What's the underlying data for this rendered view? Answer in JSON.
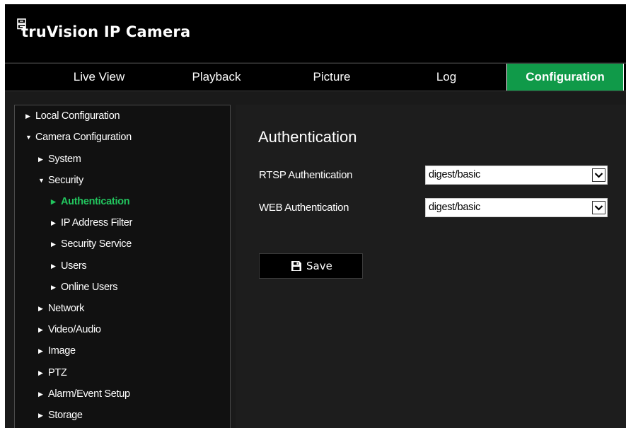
{
  "app": {
    "brand": "truVision IP Camera"
  },
  "nav": {
    "tabs": [
      {
        "label": "Live View"
      },
      {
        "label": "Playback"
      },
      {
        "label": "Picture"
      },
      {
        "label": "Log"
      },
      {
        "label": "Configuration"
      }
    ],
    "active_tab": "Configuration"
  },
  "sidebar": {
    "items": [
      {
        "label": "Local Configuration",
        "expanded": false
      },
      {
        "label": "Camera Configuration",
        "expanded": true
      },
      {
        "label": "System",
        "expanded": false
      },
      {
        "label": "Security",
        "expanded": true
      },
      {
        "label": "Authentication",
        "selected": true
      },
      {
        "label": "IP Address Filter"
      },
      {
        "label": "Security Service"
      },
      {
        "label": "Users"
      },
      {
        "label": "Online Users"
      },
      {
        "label": "Network"
      },
      {
        "label": "Video/Audio"
      },
      {
        "label": "Image"
      },
      {
        "label": "PTZ"
      },
      {
        "label": "Alarm/Event Setup"
      },
      {
        "label": "Storage"
      }
    ]
  },
  "main": {
    "title": "Authentication",
    "fields": [
      {
        "label": "RTSP Authentication",
        "value": "digest/basic"
      },
      {
        "label": "WEB Authentication",
        "value": "digest/basic"
      }
    ],
    "save_label": "Save"
  },
  "colors": {
    "accent": "#109a49",
    "selected_text": "#22c55e",
    "background": "#1a1a1a"
  }
}
